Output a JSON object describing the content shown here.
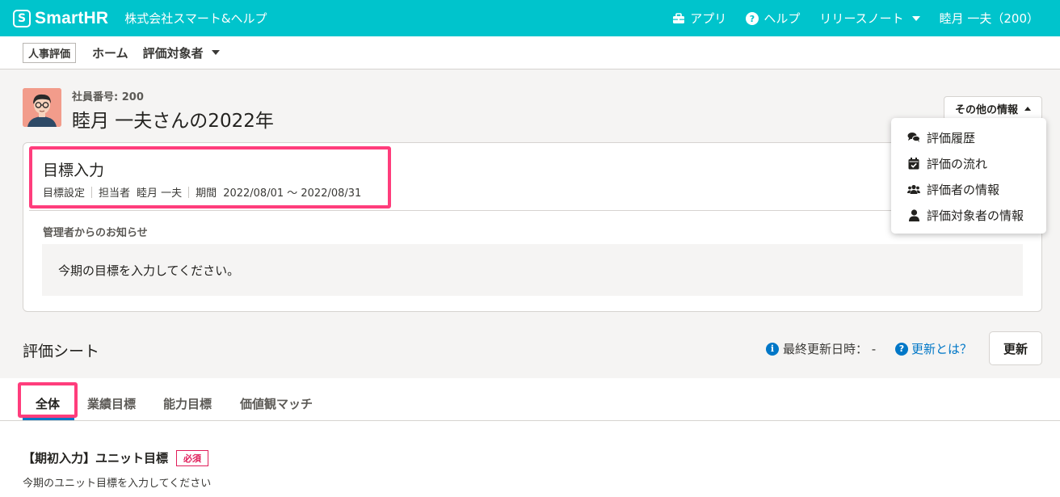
{
  "topbar": {
    "logo_mark": "S",
    "logo_text": "SmartHR",
    "company": "株式会社スマート&ヘルプ",
    "apps_label": "アプリ",
    "help_label": "ヘルプ",
    "release_notes_label": "リリースノート",
    "user_label": "睦月 一夫（200）"
  },
  "appnav": {
    "app_badge": "人事評価",
    "home": "ホーム",
    "targets": "評価対象者"
  },
  "employee": {
    "number": "社員番号: 200",
    "title": "睦月 一夫さんの2022年"
  },
  "other_info": {
    "button_label": "その他の情報",
    "menu": [
      {
        "label": "評価履歴",
        "icon": "chat-bubbles-icon"
      },
      {
        "label": "評価の流れ",
        "icon": "calendar-check-icon"
      },
      {
        "label": "評価者の情報",
        "icon": "users-icon"
      },
      {
        "label": "評価対象者の情報",
        "icon": "user-icon"
      }
    ]
  },
  "stage": {
    "title": "目標入力",
    "type": "目標設定",
    "assignee_label": "担当者",
    "assignee": "睦月 一夫",
    "period_label": "期間",
    "period": "2022/08/01 〜 2022/08/31"
  },
  "notice": {
    "label": "管理者からのお知らせ",
    "text": "今期の目標を入力してください。"
  },
  "sheet": {
    "title": "評価シート",
    "updated_label": "最終更新日時：  -",
    "help_link": "更新とは？",
    "update_button": "更新"
  },
  "tabs": [
    {
      "label": "全体",
      "active": true
    },
    {
      "label": "業績目標",
      "active": false
    },
    {
      "label": "能力目標",
      "active": false
    },
    {
      "label": "価値観マッチ",
      "active": false
    }
  ],
  "item": {
    "title": "【期初入力】ユニット目標",
    "required_badge": "必須",
    "description": "今期のユニット目標を入力してください"
  },
  "colors": {
    "brand": "#00c4cc",
    "link": "#0077c7",
    "highlight": "#ff3d7c",
    "required": "#e01e5a"
  }
}
